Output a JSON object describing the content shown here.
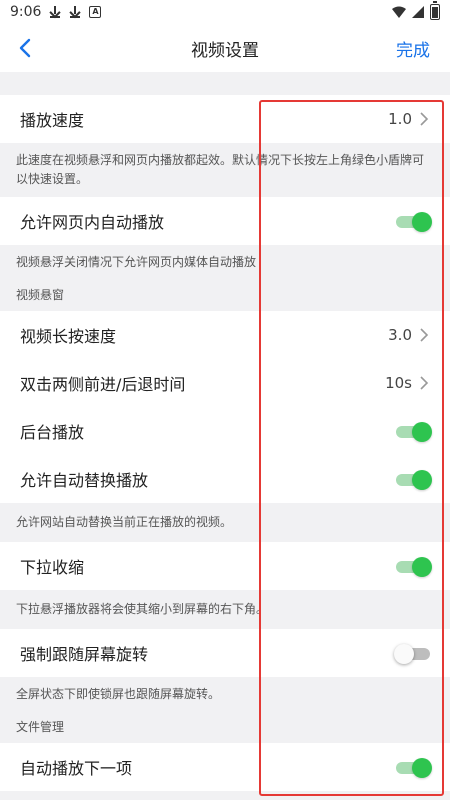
{
  "status_bar": {
    "time": "9:06",
    "icons": [
      "download-icon",
      "download-icon",
      "a-icon",
      "wifi-icon",
      "signal-icon",
      "battery-icon"
    ]
  },
  "nav": {
    "title": "视频设置",
    "done_label": "完成",
    "accent_color": "#1a73e8"
  },
  "settings": {
    "playback_speed": {
      "label": "播放速度",
      "value": "1.0"
    },
    "playback_speed_desc": "此速度在视频悬浮和网页内播放都起效。默认情况下长按左上角绿色小盾牌可以快速设置。",
    "allow_inline_autoplay": {
      "label": "允许网页内自动播放",
      "on": true
    },
    "allow_inline_autoplay_desc": "视频悬浮关闭情况下允许网页内媒体自动播放",
    "section_floating": "视频悬窗",
    "long_press_speed": {
      "label": "视频长按速度",
      "value": "3.0"
    },
    "double_tap_seek": {
      "label": "双击两侧前进/后退时间",
      "value": "10s"
    },
    "background_play": {
      "label": "后台播放",
      "on": true
    },
    "allow_auto_replace": {
      "label": "允许自动替换播放",
      "on": true
    },
    "allow_auto_replace_desc": "允许网站自动替换当前正在播放的视频。",
    "pull_down_shrink": {
      "label": "下拉收缩",
      "on": true
    },
    "pull_down_shrink_desc": "下拉悬浮播放器将会使其缩小到屏幕的右下角。",
    "force_rotate": {
      "label": "强制跟随屏幕旋转",
      "on": false
    },
    "force_rotate_desc": "全屏状态下即使锁屏也跟随屏幕旋转。",
    "section_file": "文件管理",
    "autoplay_next": {
      "label": "自动播放下一项",
      "on": true
    }
  },
  "colors": {
    "toggle_on": "#2ec44f",
    "toggle_on_track": "#a8dcb3",
    "highlight_box": "#e53935"
  }
}
